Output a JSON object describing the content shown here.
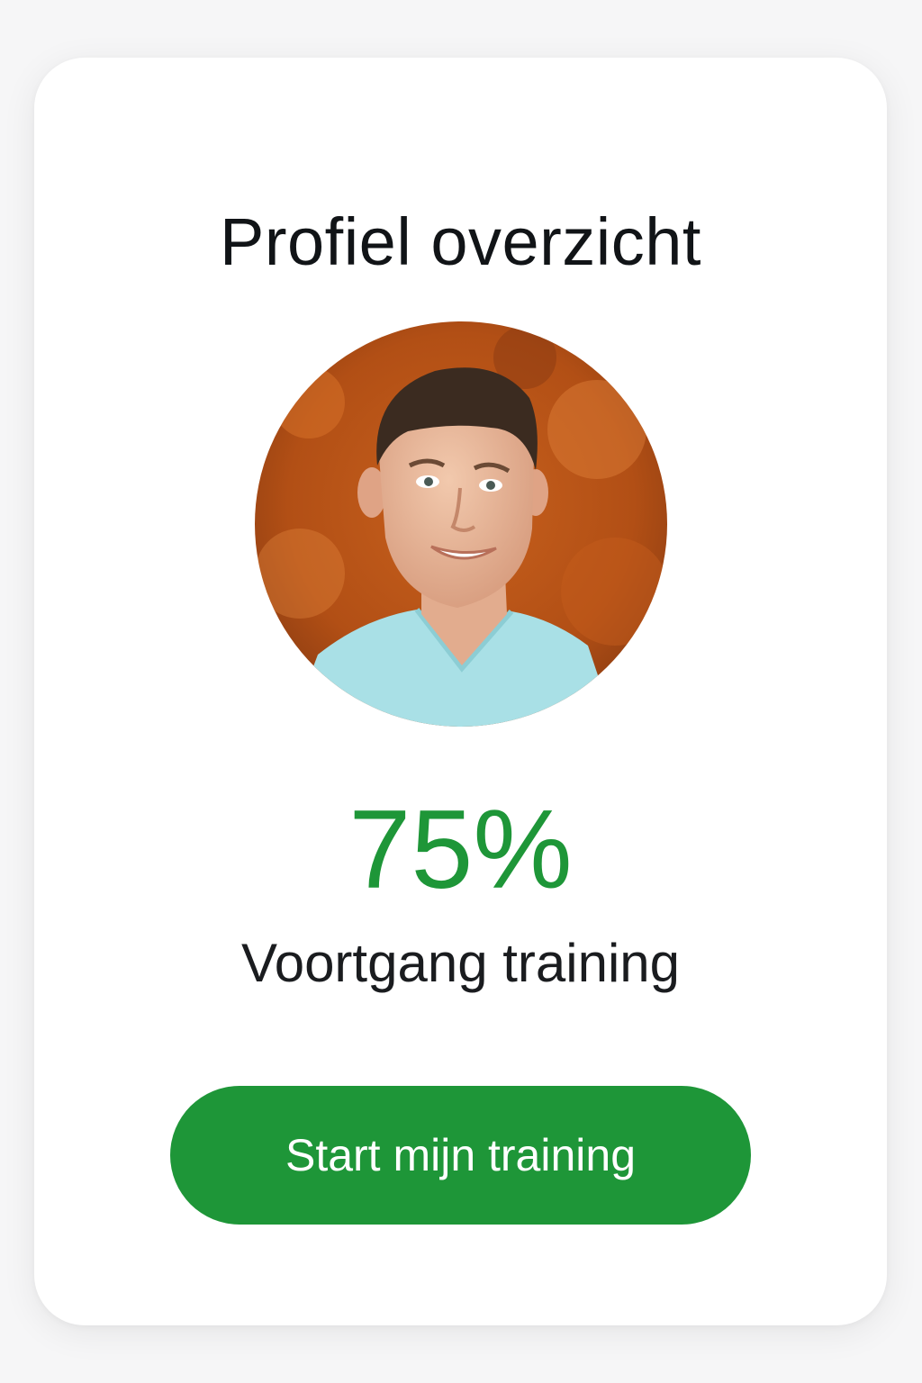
{
  "profile": {
    "title": "Profiel overzicht",
    "avatar_icon": "profile-photo-icon"
  },
  "progress": {
    "value_text": "75%",
    "value": 75,
    "label": "Voortgang training"
  },
  "actions": {
    "start_label": "Start mijn training"
  },
  "colors": {
    "accent": "#1e9638",
    "background": "#f6f6f7",
    "card": "#ffffff"
  }
}
